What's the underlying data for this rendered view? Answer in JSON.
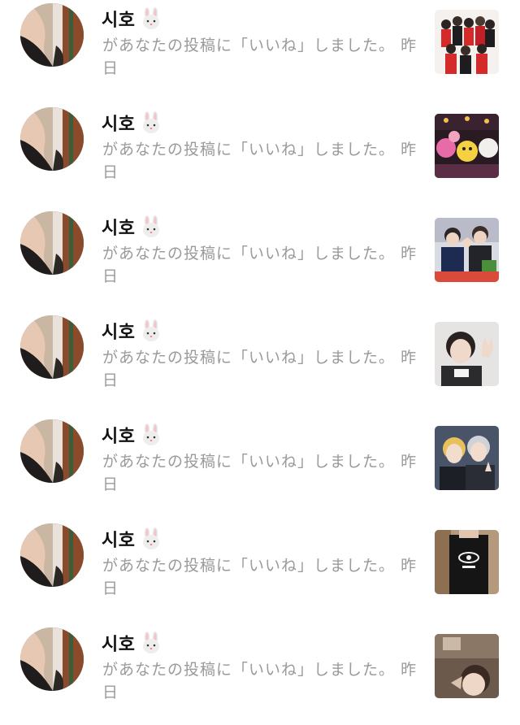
{
  "notifications": [
    {
      "user": "시호",
      "user_emoji": "rabbit-face-icon",
      "message": "があなたの投稿に「いいね」しました。",
      "time": "昨日",
      "thumbnail": "group-photo-red-thumbnail"
    },
    {
      "user": "시호",
      "user_emoji": "rabbit-face-icon",
      "message": "があなたの投稿に「いいね」しました。",
      "time": "昨日",
      "thumbnail": "stage-characters-thumbnail"
    },
    {
      "user": "시호",
      "user_emoji": "rabbit-face-icon",
      "message": "があなたの投稿に「いいね」しました。",
      "time": "昨日",
      "thumbnail": "heart-pose-thumbnail"
    },
    {
      "user": "시호",
      "user_emoji": "rabbit-face-icon",
      "message": "があなたの投稿に「いいね」しました。",
      "time": "昨日",
      "thumbnail": "selfie-wave-thumbnail"
    },
    {
      "user": "시호",
      "user_emoji": "rabbit-face-icon",
      "message": "があなたの投稿に「いいね」しました。",
      "time": "昨日",
      "thumbnail": "duo-selfie-thumbnail"
    },
    {
      "user": "시호",
      "user_emoji": "rabbit-face-icon",
      "message": "があなたの投稿に「いいね」しました。",
      "time": "昨日",
      "thumbnail": "black-hoodie-thumbnail"
    },
    {
      "user": "시호",
      "user_emoji": "rabbit-face-icon",
      "message": "があなたの投稿に「いいね」しました。",
      "time": "昨日",
      "thumbnail": "room-selfie-thumbnail"
    }
  ]
}
